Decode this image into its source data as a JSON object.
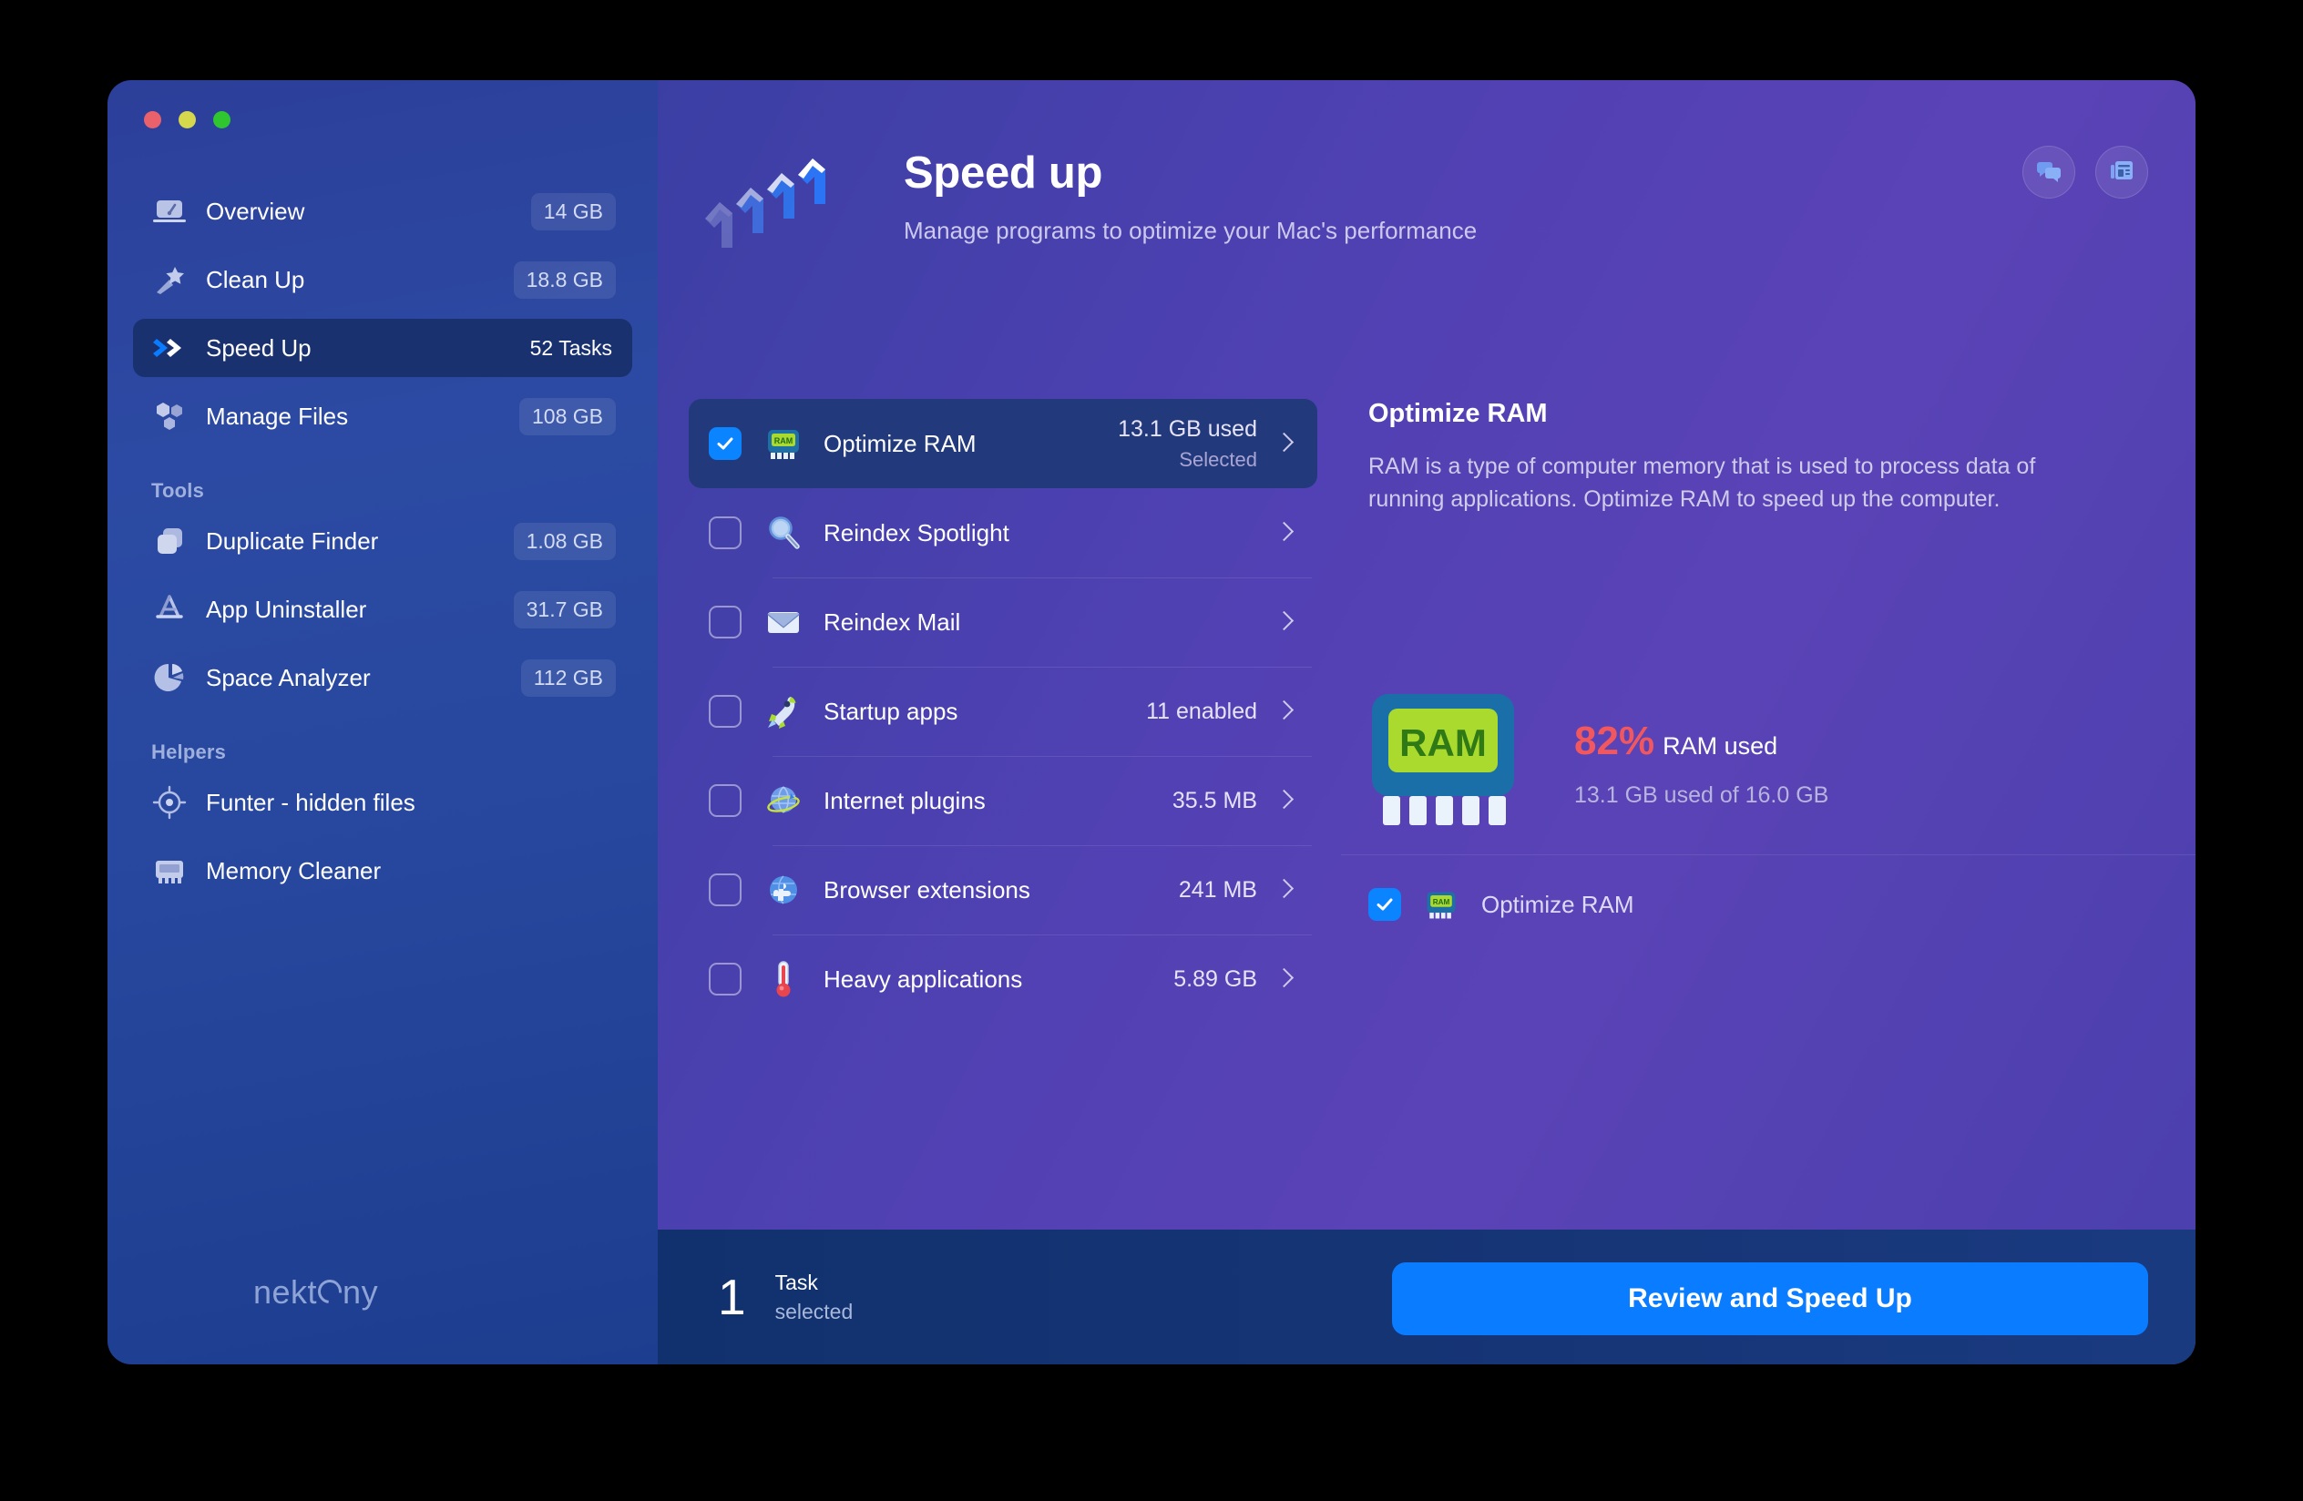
{
  "window": {
    "traffic_lights": [
      "close",
      "minimize",
      "zoom"
    ],
    "brand": "nektony"
  },
  "sidebar": {
    "main_items": [
      {
        "label": "Overview",
        "badge": "14 GB",
        "icon": "laptop-gauge-icon",
        "active": false
      },
      {
        "label": "Clean Up",
        "badge": "18.8 GB",
        "icon": "magic-wand-icon",
        "active": false
      },
      {
        "label": "Speed Up",
        "badge": "52 Tasks",
        "icon": "double-chevron-icon",
        "active": true
      },
      {
        "label": "Manage Files",
        "badge": "108 GB",
        "icon": "hexagons-icon",
        "active": false
      }
    ],
    "tools_label": "Tools",
    "tools_items": [
      {
        "label": "Duplicate Finder",
        "badge": "1.08 GB",
        "icon": "duplicate-files-icon"
      },
      {
        "label": "App Uninstaller",
        "badge": "31.7 GB",
        "icon": "app-store-icon"
      },
      {
        "label": "Space Analyzer",
        "badge": "112 GB",
        "icon": "pie-chart-icon"
      }
    ],
    "helpers_label": "Helpers",
    "helpers_items": [
      {
        "label": "Funter - hidden files",
        "badge": "",
        "icon": "target-icon"
      },
      {
        "label": "Memory Cleaner",
        "badge": "",
        "icon": "memory-chip-icon"
      }
    ]
  },
  "header": {
    "title": "Speed up",
    "subtitle": "Manage programs to optimize your Mac's performance",
    "icon": "speed-chevrons-icon",
    "actions": [
      {
        "name": "chat-icon",
        "tooltip": "Support chat"
      },
      {
        "name": "news-icon",
        "tooltip": "News"
      }
    ]
  },
  "tasks": [
    {
      "name": "Optimize RAM",
      "icon": "ram-chip-icon",
      "value": "13.1 GB used",
      "sub": "Selected",
      "checked": true,
      "selected": true
    },
    {
      "name": "Reindex Spotlight",
      "icon": "magnifier-icon",
      "value": "",
      "sub": "",
      "checked": false,
      "selected": false
    },
    {
      "name": "Reindex Mail",
      "icon": "envelope-icon",
      "value": "",
      "sub": "",
      "checked": false,
      "selected": false
    },
    {
      "name": "Startup apps",
      "icon": "rocket-icon",
      "value": "11 enabled",
      "sub": "",
      "checked": false,
      "selected": false
    },
    {
      "name": "Internet plugins",
      "icon": "globe-orbit-icon",
      "value": "35.5 MB",
      "sub": "",
      "checked": false,
      "selected": false
    },
    {
      "name": "Browser extensions",
      "icon": "globe-puzzle-icon",
      "value": "241 MB",
      "sub": "",
      "checked": false,
      "selected": false
    },
    {
      "name": "Heavy applications",
      "icon": "thermometer-icon",
      "value": "5.89 GB",
      "sub": "",
      "checked": false,
      "selected": false
    }
  ],
  "detail": {
    "title": "Optimize RAM",
    "description": "RAM is a type of computer memory that is used to process data of running applications. Optimize RAM to speed up the computer.",
    "ram_chip_label": "RAM",
    "ram_percent": "82%",
    "ram_percent_label": "RAM used",
    "ram_usage": "13.1 GB used of 16.0 GB",
    "footer_checkbox_label": "Optimize RAM",
    "footer_checkbox_checked": true
  },
  "bottom": {
    "count": "1",
    "count_label_line1": "Task",
    "count_label_line2": "selected",
    "primary_button": "Review and Speed Up"
  },
  "colors": {
    "accent_blue": "#0a7cff",
    "checkbox_blue": "#0a84ff",
    "ram_red": "#f0575e",
    "ram_green": "#b0e030",
    "sidebar_active": "#1a3170",
    "row_selected": "#223a7c"
  }
}
